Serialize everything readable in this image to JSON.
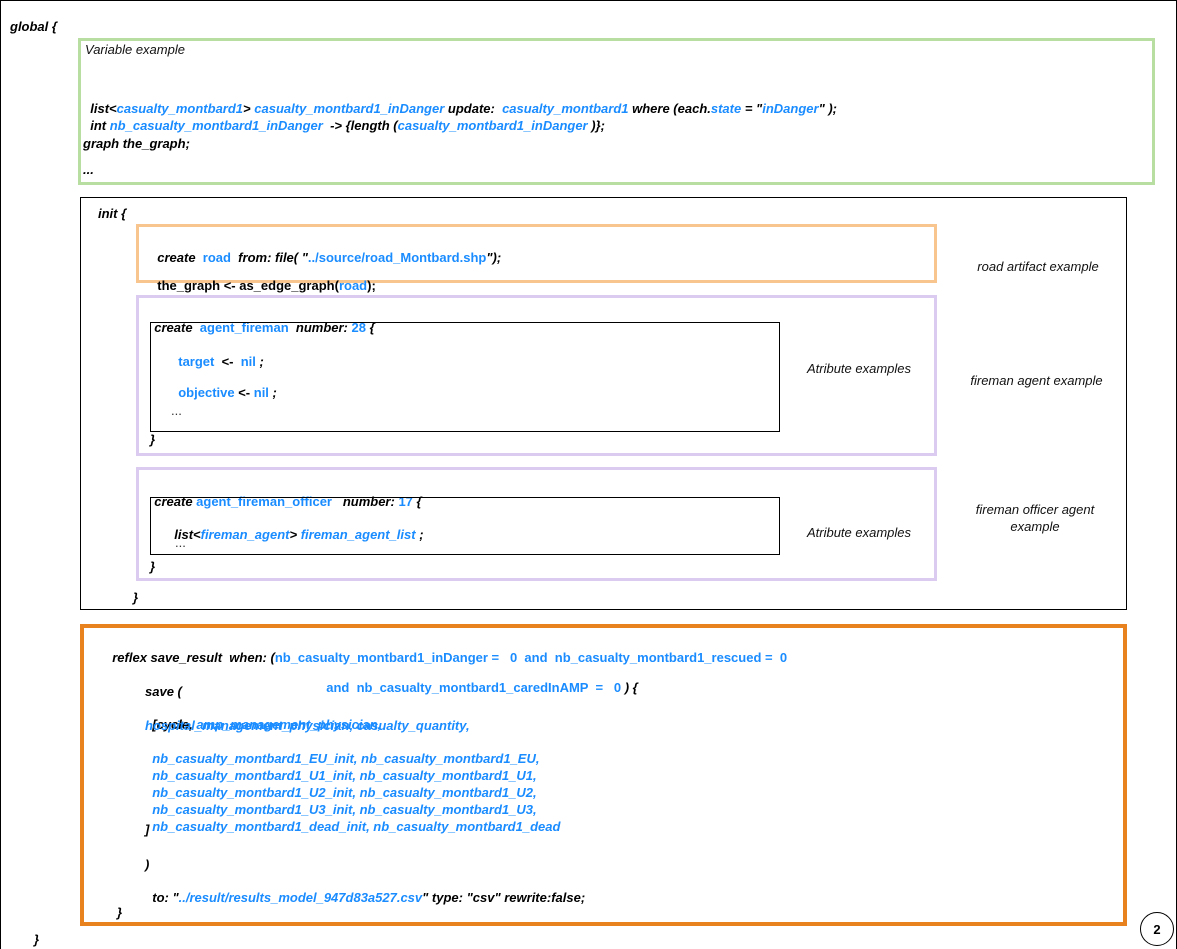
{
  "global_open": "global {",
  "global_close": "}",
  "page_number": "2",
  "variable_block": {
    "caption": "Variable example",
    "line1": {
      "kw1": "list<",
      "type": "casualty_montbard1",
      "kw2": "> ",
      "name": "casualty_montbard1_inDanger",
      "kw3": " update:  ",
      "src": "casualty_montbard1",
      "kw4": " where (each.",
      "attr": "state",
      "kw5": " = \"",
      "val": "inDanger",
      "kw6": "\" );"
    },
    "line2": {
      "kw1": "int ",
      "name": "nb_casualty_montbard1_inDanger",
      "kw2": "  -> {length (",
      "arg": "casualty_montbard1_inDanger",
      "kw3": " )};"
    },
    "line3": "graph the_graph;",
    "line4": "..."
  },
  "init_block": {
    "open": "init {",
    "close": "}",
    "road": {
      "label": "road artifact example",
      "l1_kw1": "create  ",
      "l1_name": "road",
      "l1_kw2": "  from: file( \"",
      "l1_path": "../source/road_Montbard.shp",
      "l1_kw3": "\");",
      "l2_kw1": "the_graph <- as_edge_graph(",
      "l2_arg": "road",
      "l2_kw2": ");"
    },
    "fireman": {
      "label": "fireman agent example",
      "attr_label": "Atribute examples",
      "kw_create": "create  ",
      "name": "agent_fireman",
      "kw_number": "  number: ",
      "count": "28",
      "brace": " {",
      "a1": "target",
      "a1_op": "  <-  ",
      "a1_val": "nil",
      "a1_end": " ;",
      "a2": "objective",
      "a2_op": " <- ",
      "a2_val": "nil",
      "a2_end": " ;",
      "dots": "...",
      "close": "}"
    },
    "officer": {
      "label": "fireman officer agent example",
      "attr_label": "Atribute examples",
      "kw_create": "create ",
      "name": "agent_fireman_officer",
      "kw_number": "   number: ",
      "count": "17",
      "brace": " {",
      "a1_kw": "list<",
      "a1_type": "fireman_agent",
      "a1_kw2": "> ",
      "a1_name": "fireman_agent_list",
      "a1_end": " ;",
      "dots": "...",
      "close": "}"
    }
  },
  "reflex_block": {
    "l1_kw": "reflex save_result  when: (",
    "l1_cond": "nb_casualty_montbard1_inDanger =   0  and  nb_casualty_montbard1_rescued =  0",
    "l2_cond": "and  nb_casualty_montbard1_caredInAMP  =   0 ",
    "l2_kw": ") {",
    "save_open": "save (",
    "list_open": "[cycle, ",
    "v1": "amp_management_physician,",
    "v2": "hospital_management_physician, casualty_quantity,",
    "v3a": "nb_casualty_montbard1_EU_init,",
    "v3b": " nb_casualty_montbard1_EU,",
    "v4a": "nb_casualty_montbard1_U1_init,",
    "v4b": " nb_casualty_montbard1_U1,",
    "v5a": "nb_casualty_montbard1_U2_init,",
    "v5b": " nb_casualty_montbard1_U2,",
    "v6a": "nb_casualty_montbard1_U3_init,",
    "v6b": " nb_casualty_montbard1_U3,",
    "v7a": "nb_casualty_montbard1_dead_init,",
    "v7b": " nb_casualty_montbard1_dead",
    "list_close": "]",
    "paren_close": ")",
    "to_kw": "to: \"",
    "to_path": "../result/results_model_947d83a527.csv",
    "to_kw2": "\" type: \"csv\" rewrite:false;",
    "close": "}"
  }
}
